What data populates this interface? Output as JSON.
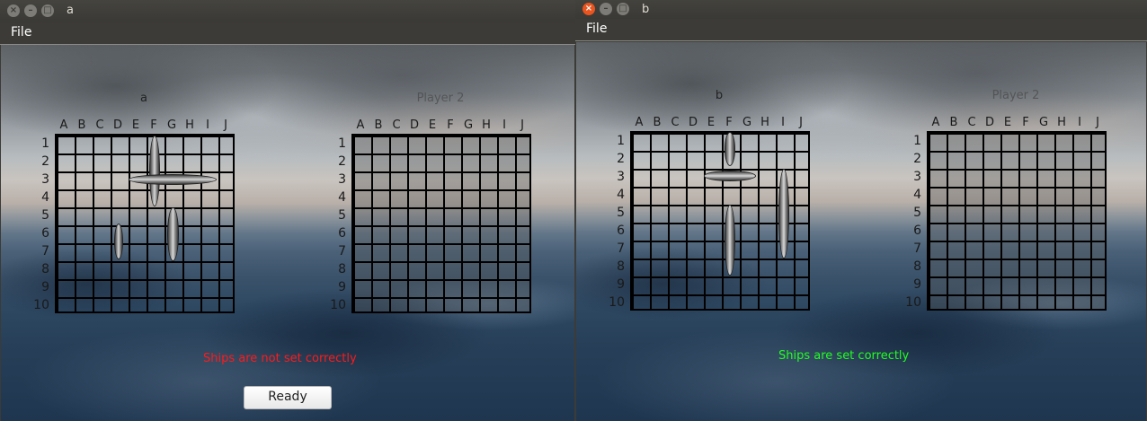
{
  "windows": [
    {
      "title": "a",
      "menu": "File",
      "board_title": "a",
      "enemy_title": "Player 2",
      "status": "Ships are not set correctly",
      "status_kind": "error",
      "ready_button": "Ready"
    },
    {
      "title": "b",
      "menu": "File",
      "board_title": "b",
      "enemy_title": "Player 2",
      "status": "Ships are set correctly",
      "status_kind": "ok"
    }
  ],
  "grid": {
    "columns": [
      "A",
      "B",
      "C",
      "D",
      "E",
      "F",
      "G",
      "H",
      "I",
      "J"
    ],
    "rows": [
      "1",
      "2",
      "3",
      "4",
      "5",
      "6",
      "7",
      "8",
      "9",
      "10"
    ]
  },
  "window_buttons": {
    "close": "×",
    "minimize": "–",
    "maximize": "□"
  },
  "colors": {
    "status_error": "#ff1a1a",
    "status_ok": "#20ff20",
    "close_active": "#e9541f"
  }
}
